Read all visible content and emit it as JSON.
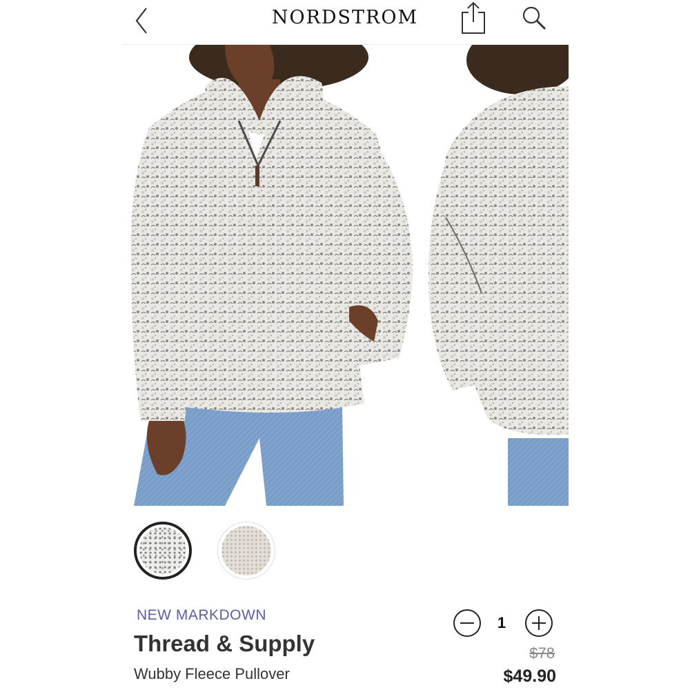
{
  "header": {
    "brand": "NORDSTROM",
    "back_icon": "chevron-left-icon",
    "share_icon": "share-icon",
    "search_icon": "search-icon"
  },
  "gallery": {
    "images": [
      {
        "name": "front-view"
      },
      {
        "name": "back-view"
      }
    ]
  },
  "swatches": [
    {
      "name": "heather-grey",
      "selected": true
    },
    {
      "name": "cream",
      "selected": false
    }
  ],
  "product": {
    "badge": "NEW MARKDOWN",
    "brand": "Thread & Supply",
    "name": "Wubby Fleece Pullover",
    "original_price": "$78",
    "sale_price": "$49.90"
  },
  "quantity": {
    "value": "1"
  },
  "colors": {
    "badge": "#5a5ea8",
    "text": "#333333"
  }
}
